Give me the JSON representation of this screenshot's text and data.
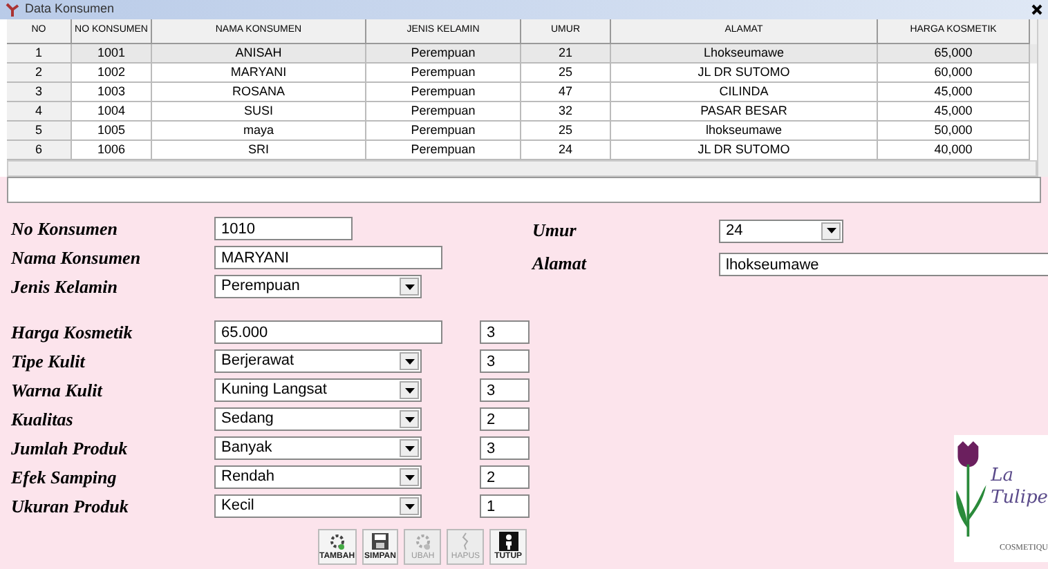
{
  "window": {
    "title": "Data Konsumen"
  },
  "table": {
    "columns": [
      "NO",
      "NO KONSUMEN",
      "NAMA KONSUMEN",
      "JENIS KELAMIN",
      "UMUR",
      "ALAMAT",
      "HARGA KOSMETIK"
    ],
    "rows": [
      {
        "cells": [
          "1",
          "1001",
          "ANISAH",
          "Perempuan",
          "21",
          "Lhokseumawe",
          "65,000"
        ],
        "selected": true
      },
      {
        "cells": [
          "2",
          "1002",
          "MARYANI",
          "Perempuan",
          "25",
          "JL DR SUTOMO",
          "60,000"
        ],
        "selected": false
      },
      {
        "cells": [
          "3",
          "1003",
          "ROSANA",
          "Perempuan",
          "47",
          "CILINDA",
          "45,000"
        ],
        "selected": false
      },
      {
        "cells": [
          "4",
          "1004",
          "SUSI",
          "Perempuan",
          "32",
          "PASAR BESAR",
          "45,000"
        ],
        "selected": false
      },
      {
        "cells": [
          "5",
          "1005",
          "maya",
          "Perempuan",
          "25",
          "lhokseumawe",
          "50,000"
        ],
        "selected": false
      },
      {
        "cells": [
          "6",
          "1006",
          "SRI",
          "Perempuan",
          "24",
          "JL DR SUTOMO",
          "40,000"
        ],
        "selected": false
      }
    ]
  },
  "form": {
    "fields": [
      {
        "label": "No Konsumen",
        "kind": "text",
        "value": "1010"
      },
      {
        "label": "Nama Konsumen",
        "kind": "text",
        "value": "MARYANI"
      },
      {
        "label": "Jenis Kelamin",
        "kind": "combo",
        "value": "Perempuan"
      },
      {
        "label": "Harga Kosmetik",
        "kind": "text",
        "value": "65.000",
        "score": "3"
      },
      {
        "label": "Tipe Kulit",
        "kind": "combo",
        "value": "Berjerawat",
        "score": "3"
      },
      {
        "label": "Warna Kulit",
        "kind": "combo",
        "value": "Kuning Langsat",
        "score": "3"
      },
      {
        "label": "Kualitas",
        "kind": "combo",
        "value": "Sedang",
        "score": "2"
      },
      {
        "label": "Jumlah Produk",
        "kind": "combo",
        "value": "Banyak",
        "score": "3"
      },
      {
        "label": "Efek Samping",
        "kind": "combo",
        "value": "Rendah",
        "score": "2"
      },
      {
        "label": "Ukuran Produk",
        "kind": "combo",
        "value": "Kecil",
        "score": "1"
      }
    ],
    "right_fields": [
      {
        "label": "Umur",
        "kind": "combo",
        "value": "24"
      },
      {
        "label": "Alamat",
        "kind": "text",
        "value": "lhokseumawe"
      }
    ]
  },
  "buttons": [
    {
      "label": "TAMBAH",
      "disabled": false
    },
    {
      "label": "SIMPAN",
      "disabled": false
    },
    {
      "label": "UBAH",
      "disabled": true
    },
    {
      "label": "HAPUS",
      "disabled": true
    },
    {
      "label": "TUTUP",
      "disabled": false
    }
  ],
  "logo": {
    "line1": "La",
    "line2": "Tulipe",
    "tagline": "COSMETIQU"
  }
}
